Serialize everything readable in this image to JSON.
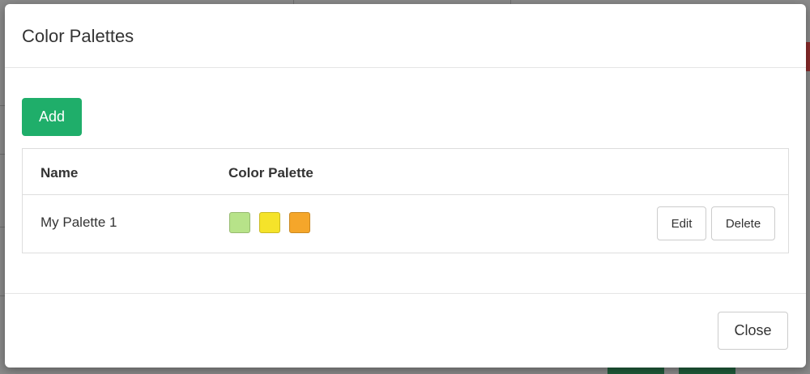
{
  "modal": {
    "title": "Color Palettes",
    "add_label": "Add",
    "close_label": "Close"
  },
  "table": {
    "columns": [
      "Name",
      "Color Palette"
    ],
    "rows": [
      {
        "name": "My Palette 1",
        "colors": [
          "#b7e389",
          "#f5e32a",
          "#f5a62a"
        ],
        "edit_label": "Edit",
        "delete_label": "Delete"
      }
    ]
  },
  "colors": {
    "primary": "#1fae6a",
    "border": "#dddddd",
    "text": "#333333"
  }
}
